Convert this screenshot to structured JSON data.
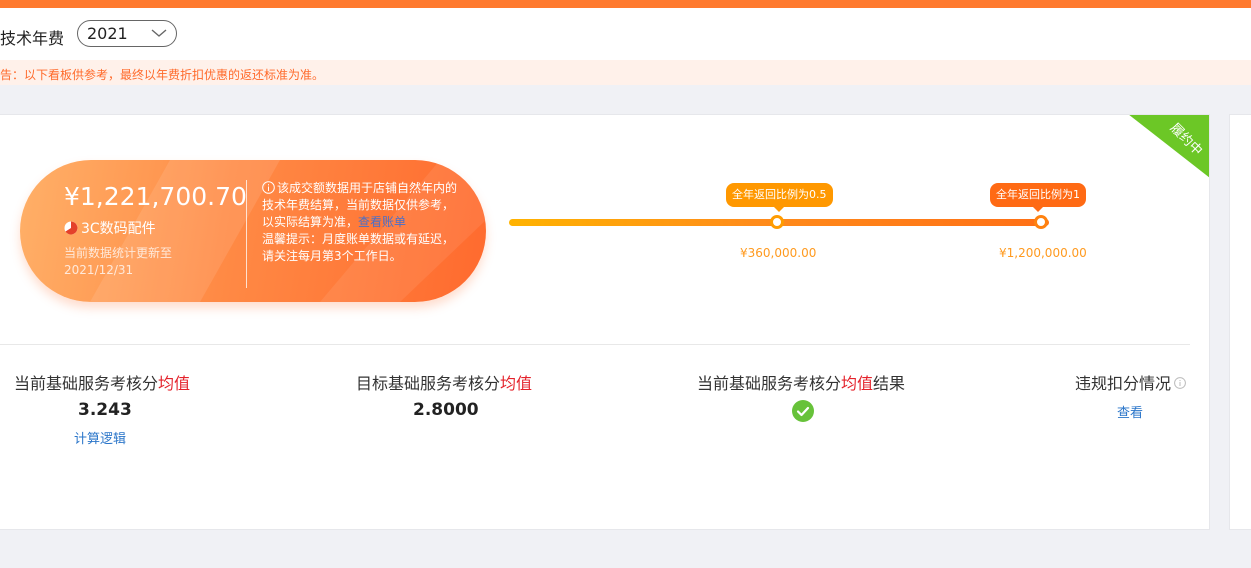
{
  "header": {
    "title": "技术年费",
    "year_selected": "2021"
  },
  "notice": {
    "text": "告：以下看板供参考，最终以年费折扣优惠的返还标准为准。"
  },
  "badge": {
    "label": "履约中"
  },
  "summary": {
    "amount": "¥1,221,700.70",
    "category": "3C数码配件",
    "update_label": "当前数据统计更新至",
    "update_date": "2021/12/31",
    "desc_main": "该成交额数据用于店铺自然年内的技术年费结算，当前数据仅供参考，以实际结算为准，",
    "desc_link": "查看账单",
    "desc_tip": "温馨提示：月度账单数据或有延迟，请关注每月第3个工作日。"
  },
  "progress": {
    "milestones": [
      {
        "label": "全年返回比例为0.5",
        "amount": "¥360,000.00"
      },
      {
        "label": "全年返回比例为1",
        "amount": "¥1,200,000.00"
      }
    ]
  },
  "stats": {
    "current_avg": {
      "label_pre": "当前基础服务考核分",
      "label_hl": "均值",
      "value": "3.243",
      "link": "计算逻辑"
    },
    "target_avg": {
      "label_pre": "目标基础服务考核分",
      "label_hl": "均值",
      "value": "2.8000"
    },
    "result": {
      "label_pre": "当前基础服务考核分",
      "label_hl": "均值",
      "label_post": "结果",
      "status": "check-icon"
    },
    "violation": {
      "label": "违规扣分情况",
      "link": "查看"
    }
  },
  "colors": {
    "accent": "#ff7a2e",
    "highlight": "#e4222b",
    "link": "#2a75c9",
    "success": "#67c23a"
  }
}
